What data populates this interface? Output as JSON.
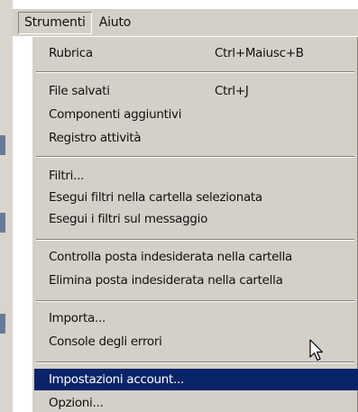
{
  "menubar": {
    "items": [
      {
        "label": "Strumenti"
      },
      {
        "label": "Aiuto"
      }
    ]
  },
  "menu": {
    "items": [
      {
        "label": "Rubrica",
        "shortcut": "Ctrl+Maiusc+B"
      },
      {
        "label": "File salvati",
        "shortcut": "Ctrl+J"
      },
      {
        "label": "Componenti aggiuntivi",
        "shortcut": ""
      },
      {
        "label": "Registro attività",
        "shortcut": ""
      },
      {
        "label": "Filtri...",
        "shortcut": ""
      },
      {
        "label": "Esegui filtri nella cartella selezionata",
        "shortcut": ""
      },
      {
        "label": "Esegui i filtri sul messaggio",
        "shortcut": ""
      },
      {
        "label": "Controlla posta indesiderata nella cartella",
        "shortcut": ""
      },
      {
        "label": "Elimina posta indesiderata nella cartella",
        "shortcut": ""
      },
      {
        "label": "Importa...",
        "shortcut": ""
      },
      {
        "label": "Console degli errori",
        "shortcut": ""
      },
      {
        "label": "Impostazioni account...",
        "shortcut": ""
      },
      {
        "label": "Opzioni...",
        "shortcut": ""
      }
    ],
    "highlighted_item": "Impostazioni account..."
  },
  "colors": {
    "menu_background": "#d4d0c8",
    "highlight_background": "#0a246a",
    "highlight_text": "#ffffff"
  }
}
